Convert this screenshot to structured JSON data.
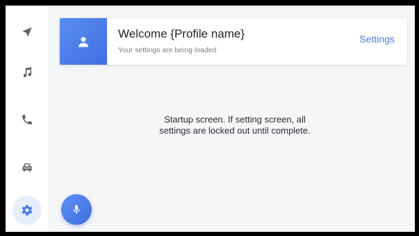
{
  "sidebar": {
    "items": [
      {
        "icon": "navigation-arrow-icon",
        "active": false
      },
      {
        "icon": "music-note-icon",
        "active": false
      },
      {
        "icon": "phone-icon",
        "active": false
      },
      {
        "icon": "car-icon",
        "active": false
      },
      {
        "icon": "gear-icon",
        "active": true
      }
    ]
  },
  "header": {
    "avatar_icon": "user-icon",
    "title": "Welcome {Profile name}",
    "subtitle": "Your settings are being loaded",
    "settings_label": "Settings"
  },
  "main": {
    "message": "Startup screen. If setting screen, all settings are locked out until complete."
  },
  "voice": {
    "icon": "microphone-icon"
  },
  "colors": {
    "accent": "#4a7de9",
    "background": "#f5f6f8",
    "sidebar": "#ffffff"
  }
}
